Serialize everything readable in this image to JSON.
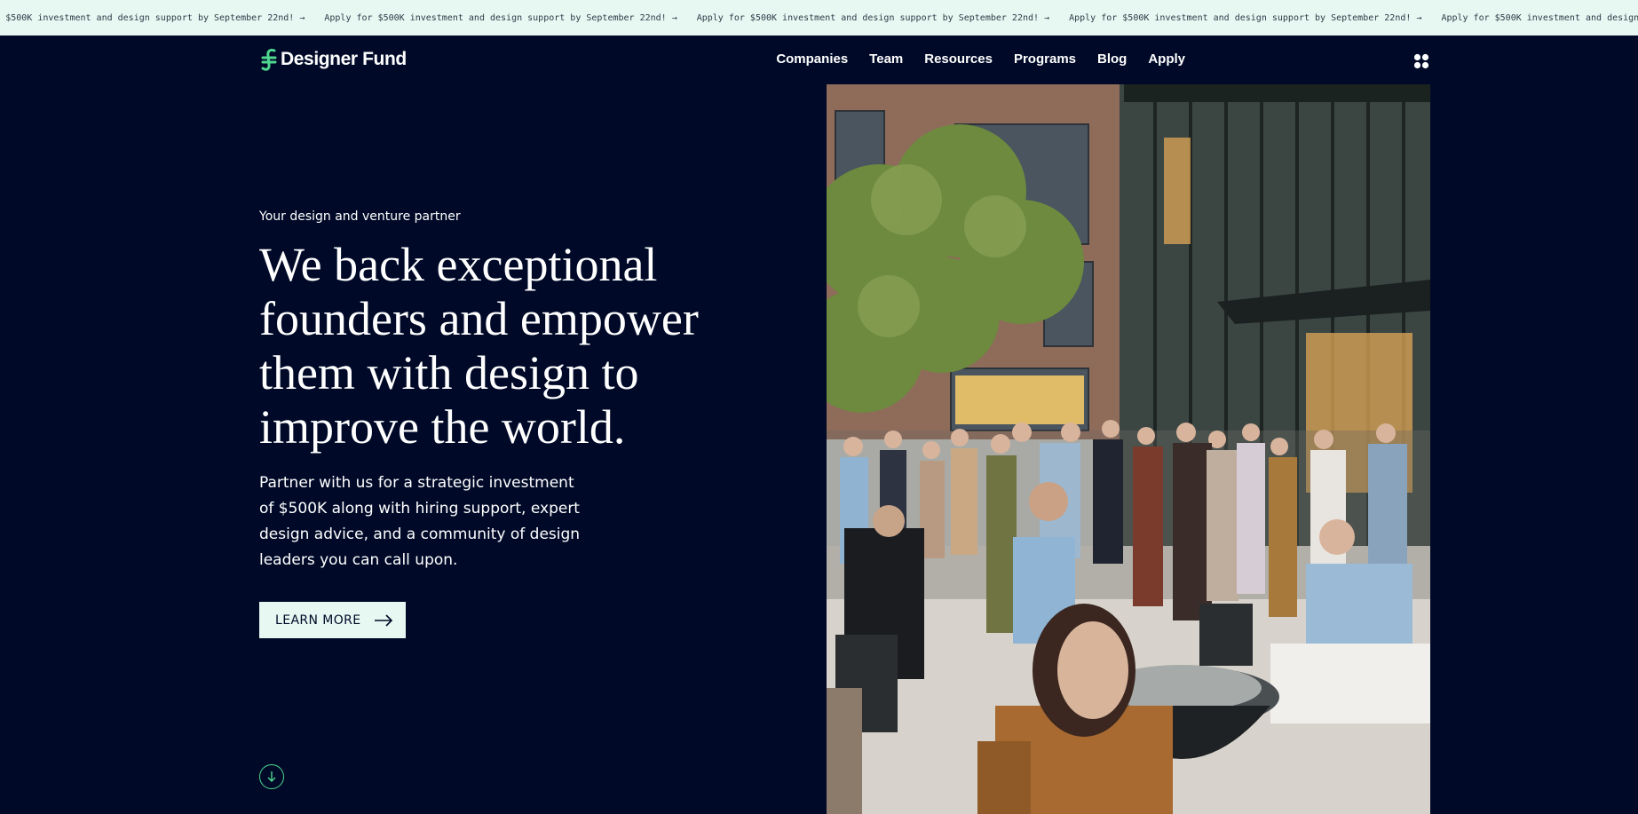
{
  "banner": {
    "message": "Apply for $500K investment and design support by September 22nd! →"
  },
  "nav": {
    "logo_text": "Designer Fund",
    "links": [
      "Companies",
      "Team",
      "Resources",
      "Programs",
      "Blog",
      "Apply"
    ],
    "menu_icon": "grid-dots-icon"
  },
  "hero": {
    "eyebrow": "Your design and venture partner",
    "headline": "We back exceptional founders and empower them with design to improve the world.",
    "subtext": "Partner with us for a strategic investment of $500K along with hiring support, expert design advice, and a community of design leaders you can call upon.",
    "cta_label": "LEARN MORE",
    "cta_icon": "arrow-right-icon",
    "scroll_icon": "arrow-down-circle-icon"
  },
  "colors": {
    "background": "#000a28",
    "banner_bg": "#e7f7f1",
    "accent_green": "#4fd68f",
    "text": "#ffffff"
  }
}
